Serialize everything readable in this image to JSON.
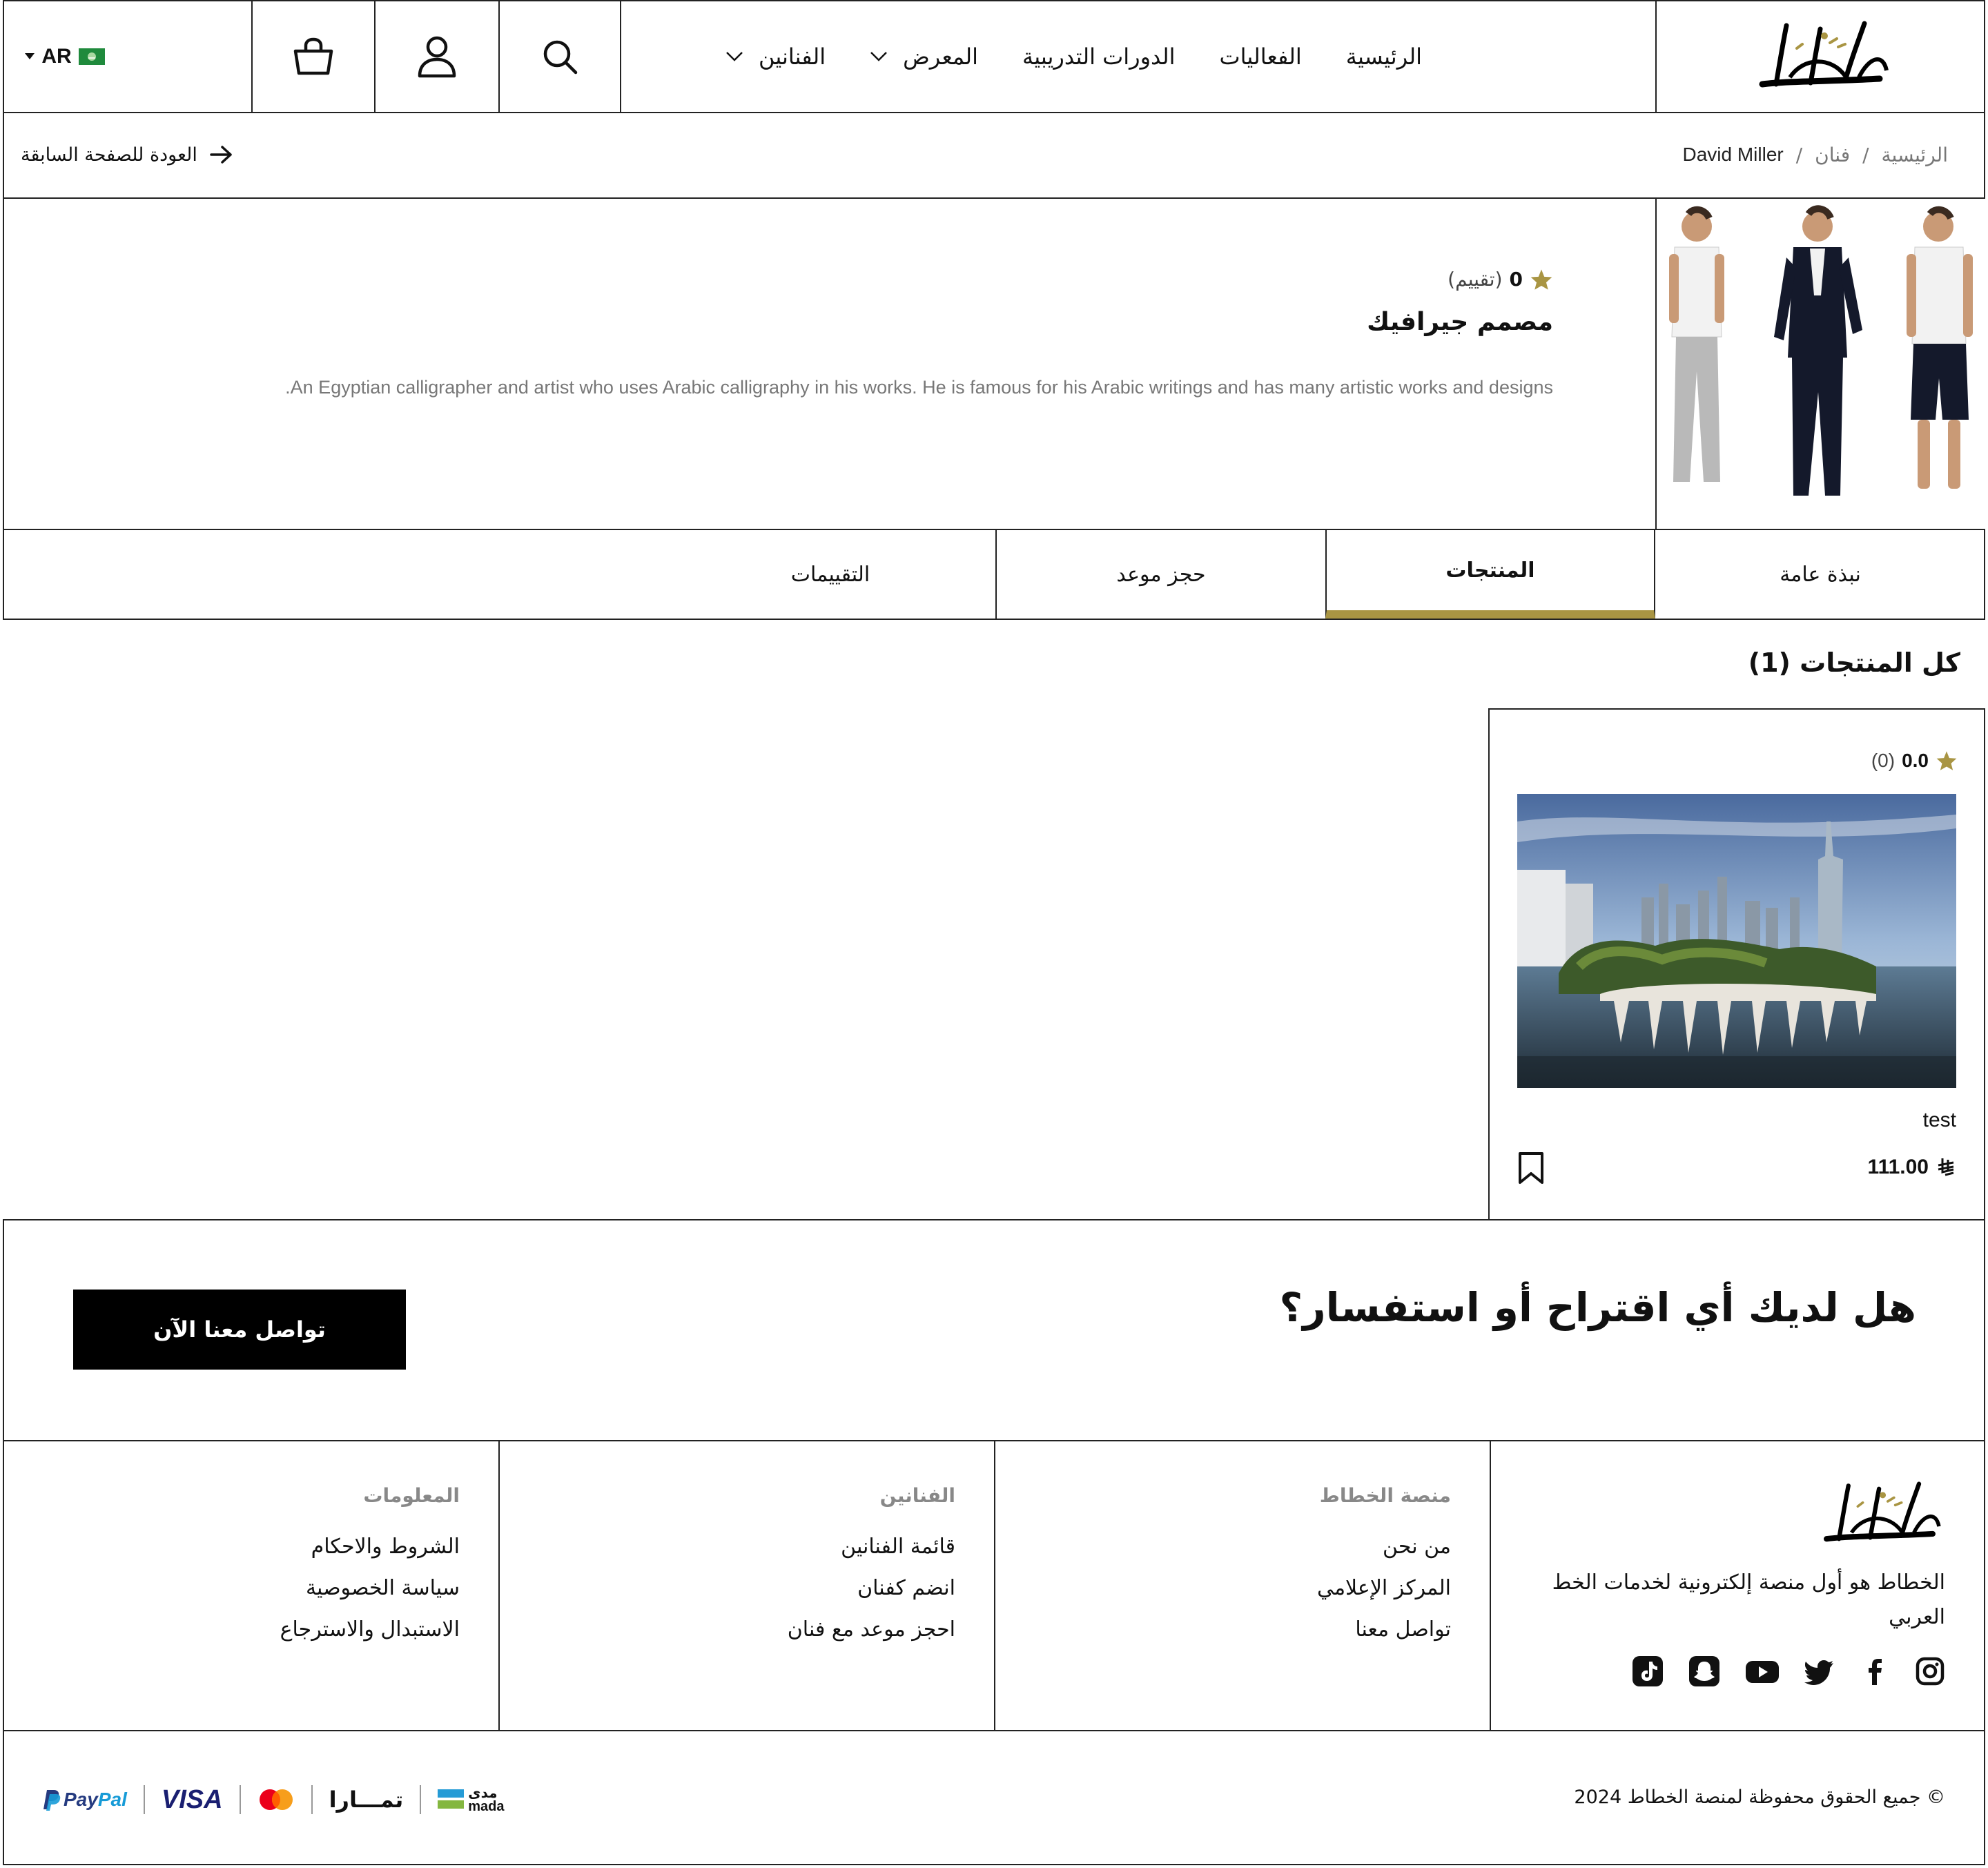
{
  "header": {
    "logo_text": "الخطاط",
    "nav": [
      {
        "label": "الرئيسية",
        "has_dropdown": false
      },
      {
        "label": "الفعاليات",
        "has_dropdown": false
      },
      {
        "label": "الدورات التدريبية",
        "has_dropdown": false
      },
      {
        "label": "المعرض",
        "has_dropdown": true
      },
      {
        "label": "الفنانين",
        "has_dropdown": true
      }
    ],
    "language": "AR",
    "icons": [
      "search-icon",
      "user-icon",
      "cart-icon",
      "flag-icon"
    ]
  },
  "breadcrumb": {
    "items": [
      "الرئيسية",
      "فنان",
      "David Miller"
    ],
    "separator": "/",
    "back_label": "العودة للصفحة السابقة"
  },
  "profile": {
    "rating_value": "0",
    "rating_label": "(تقييم)",
    "title": "مصمم جيرافيك",
    "description": ".An Egyptian calligrapher and artist who uses Arabic calligraphy in his works. He is famous for his Arabic writings and has many artistic works and designs"
  },
  "tabs": [
    {
      "label": "نبذة عامة",
      "active": false
    },
    {
      "label": "المنتجات",
      "active": true
    },
    {
      "label": "حجز موعد",
      "active": false
    },
    {
      "label": "التقييمات",
      "active": false
    }
  ],
  "products": {
    "heading": "كل المنتجات (1)",
    "items": [
      {
        "rating": "0.0",
        "count": "(0)",
        "name": "test",
        "price": "111.00",
        "currency_symbol": "⃁"
      }
    ]
  },
  "cta": {
    "question": "هل لديك أي اقتراح أو استفسار؟",
    "button": "تواصل معنا الآن"
  },
  "footer": {
    "logo_text": "الخطاط",
    "tagline": "الخطاط هو أول منصة إلكترونية لخدمات الخط العربي",
    "social": [
      "instagram-icon",
      "facebook-icon",
      "twitter-icon",
      "youtube-icon",
      "snapchat-icon",
      "tiktok-icon"
    ],
    "columns": [
      {
        "title": "منصة الخطاط",
        "links": [
          "من نحن",
          "المركز الإعلامي",
          "تواصل معنا"
        ]
      },
      {
        "title": "الفنانين",
        "links": [
          "قائمة الفنانين",
          "انضم كفنان",
          "احجز موعد مع فنان"
        ]
      },
      {
        "title": "المعلومات",
        "links": [
          "الشروط والاحكام",
          "سياسة الخصوصية",
          "الاستبدال والاسترجاع"
        ]
      }
    ],
    "copyright": "© جميع الحقوق محفوظة لمنصة الخطاط 2024",
    "payments": {
      "mada_ar": "مدى",
      "mada_en": "mada",
      "tamara": "تمـــارا",
      "mastercard": "mastercard",
      "visa": "VISA",
      "paypal_pay": "Pay",
      "paypal_pal": "Pal"
    }
  },
  "colors": {
    "accent": "#a99543",
    "black": "#000000",
    "border": "#222222"
  }
}
